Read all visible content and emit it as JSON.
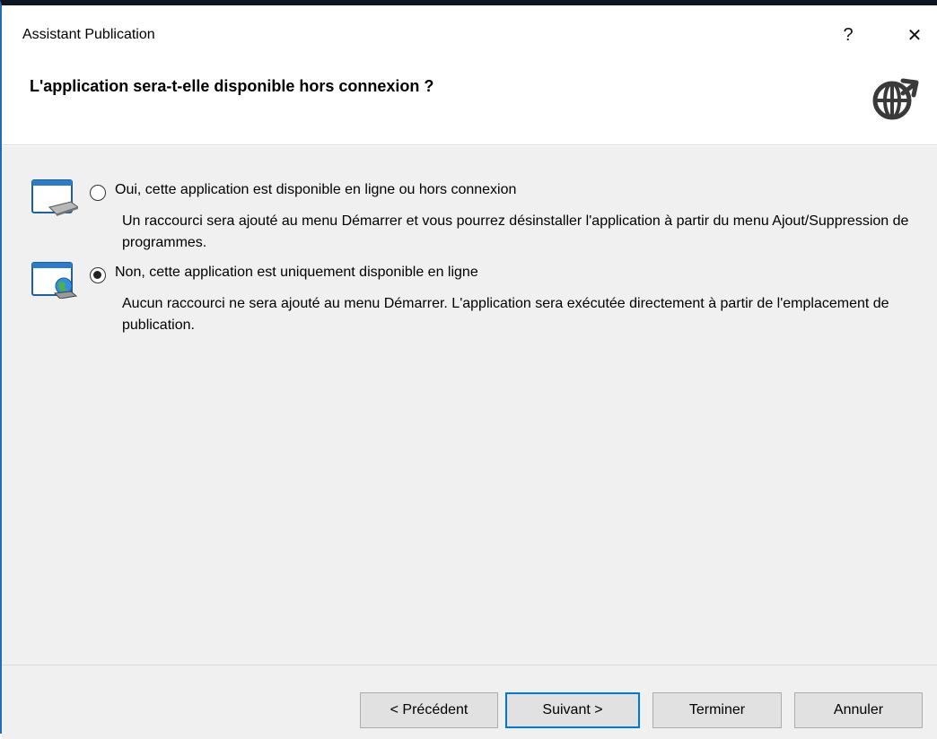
{
  "window": {
    "title": "Assistant Publication",
    "help_label": "?",
    "close_label": "✕"
  },
  "header": {
    "title": "L'application sera-t-elle disponible hors connexion ?",
    "icon": "globe-publish-icon"
  },
  "options": [
    {
      "icon": "app-offline-icon",
      "label": "Oui, cette application est disponible en ligne ou hors connexion",
      "description": "Un raccourci sera ajouté au menu Démarrer et vous pourrez désinstaller l'application à partir du menu Ajout/Suppression de programmes.",
      "selected": false
    },
    {
      "icon": "app-online-icon",
      "label": "Non, cette application est uniquement disponible en ligne",
      "description": "Aucun raccourci ne sera ajouté au menu Démarrer. L'application sera exécutée directement à partir de l'emplacement de publication.",
      "selected": true
    }
  ],
  "footer": {
    "previous_label": "< Précédent",
    "next_label": "Suivant >",
    "finish_label": "Terminer",
    "cancel_label": "Annuler"
  },
  "colors": {
    "accent": "#0078d7",
    "content_bg": "#f0f0f0"
  }
}
